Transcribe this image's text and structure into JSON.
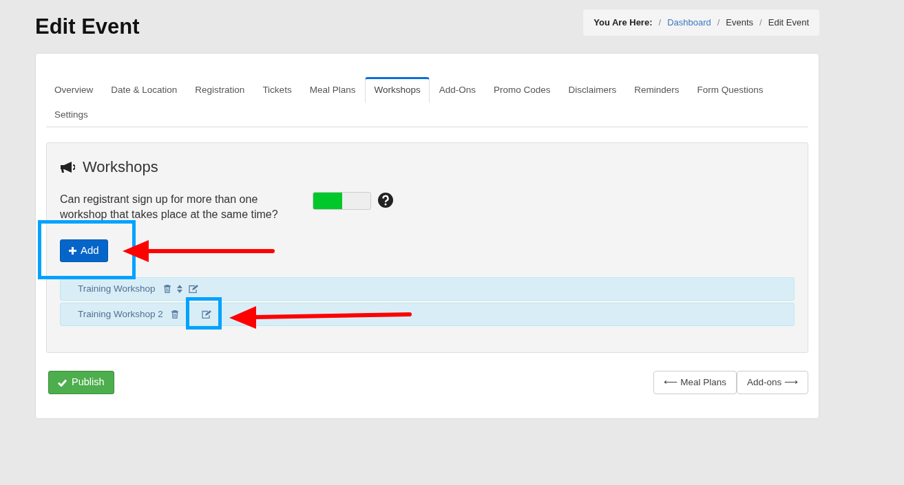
{
  "page_title": "Edit Event",
  "breadcrumb": {
    "label": "You Are Here:",
    "separator": "/",
    "items": [
      {
        "text": "Dashboard",
        "kind": "link"
      },
      {
        "text": "Events",
        "kind": "plain"
      },
      {
        "text": "Edit Event",
        "kind": "plain"
      }
    ]
  },
  "tabs": [
    {
      "label": "Overview",
      "selected": false
    },
    {
      "label": "Date & Location",
      "selected": false
    },
    {
      "label": "Registration",
      "selected": false
    },
    {
      "label": "Tickets",
      "selected": false
    },
    {
      "label": "Meal Plans",
      "selected": false
    },
    {
      "label": "Workshops",
      "selected": true
    },
    {
      "label": "Add-Ons",
      "selected": false
    },
    {
      "label": "Promo Codes",
      "selected": false
    },
    {
      "label": "Disclaimers",
      "selected": false
    },
    {
      "label": "Reminders",
      "selected": false
    },
    {
      "label": "Form Questions",
      "selected": false
    },
    {
      "label": "Settings",
      "selected": false
    }
  ],
  "panel": {
    "title": "Workshops",
    "question": "Can registrant sign up for more than one workshop that takes place at the same time?",
    "toggle": {
      "on": true
    },
    "add_button": "Add"
  },
  "workshops": [
    {
      "name": "Training Workshop",
      "sortable": true
    },
    {
      "name": "Training Workshop 2",
      "sortable": false
    }
  ],
  "footer": {
    "publish_button": "Publish",
    "prev_button": "⟵ Meal Plans",
    "next_button": "Add-ons ⟶"
  }
}
